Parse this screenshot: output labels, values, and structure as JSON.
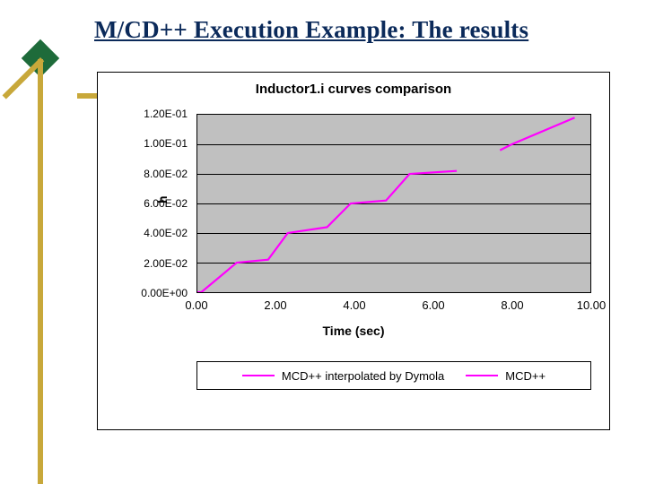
{
  "slide_title": "M/CD++ Execution Example: The results",
  "chart_data": {
    "type": "line",
    "title": "Inductor1.i curves comparison",
    "xlabel": "Time (sec)",
    "ylabel": "h",
    "xlim": [
      0.0,
      10.0
    ],
    "ylim": [
      0.0,
      0.12
    ],
    "x_ticks": [
      "0.00",
      "2.00",
      "4.00",
      "6.00",
      "8.00",
      "10.00"
    ],
    "y_ticks": [
      "0.00E+00",
      "2.00E-02",
      "4.00E-02",
      "6.00E-02",
      "8.00E-02",
      "1.00E-01",
      "1.20E-01"
    ],
    "series": [
      {
        "name": "MCD++ interpolated by Dymola",
        "color": "#ff00ff",
        "x": [
          0.0,
          0.1,
          1.0,
          1.8,
          2.3,
          3.3,
          3.9,
          4.8,
          5.4,
          6.6
        ],
        "values": [
          0.0,
          0.0,
          0.02,
          0.022,
          0.04,
          0.044,
          0.06,
          0.062,
          0.08,
          0.082
        ]
      },
      {
        "name": "MCD++",
        "color": "#ff00ff",
        "x": [
          7.7,
          8.0,
          9.6
        ],
        "values": [
          0.096,
          0.1,
          0.118
        ]
      }
    ],
    "legend_position": "bottom"
  }
}
